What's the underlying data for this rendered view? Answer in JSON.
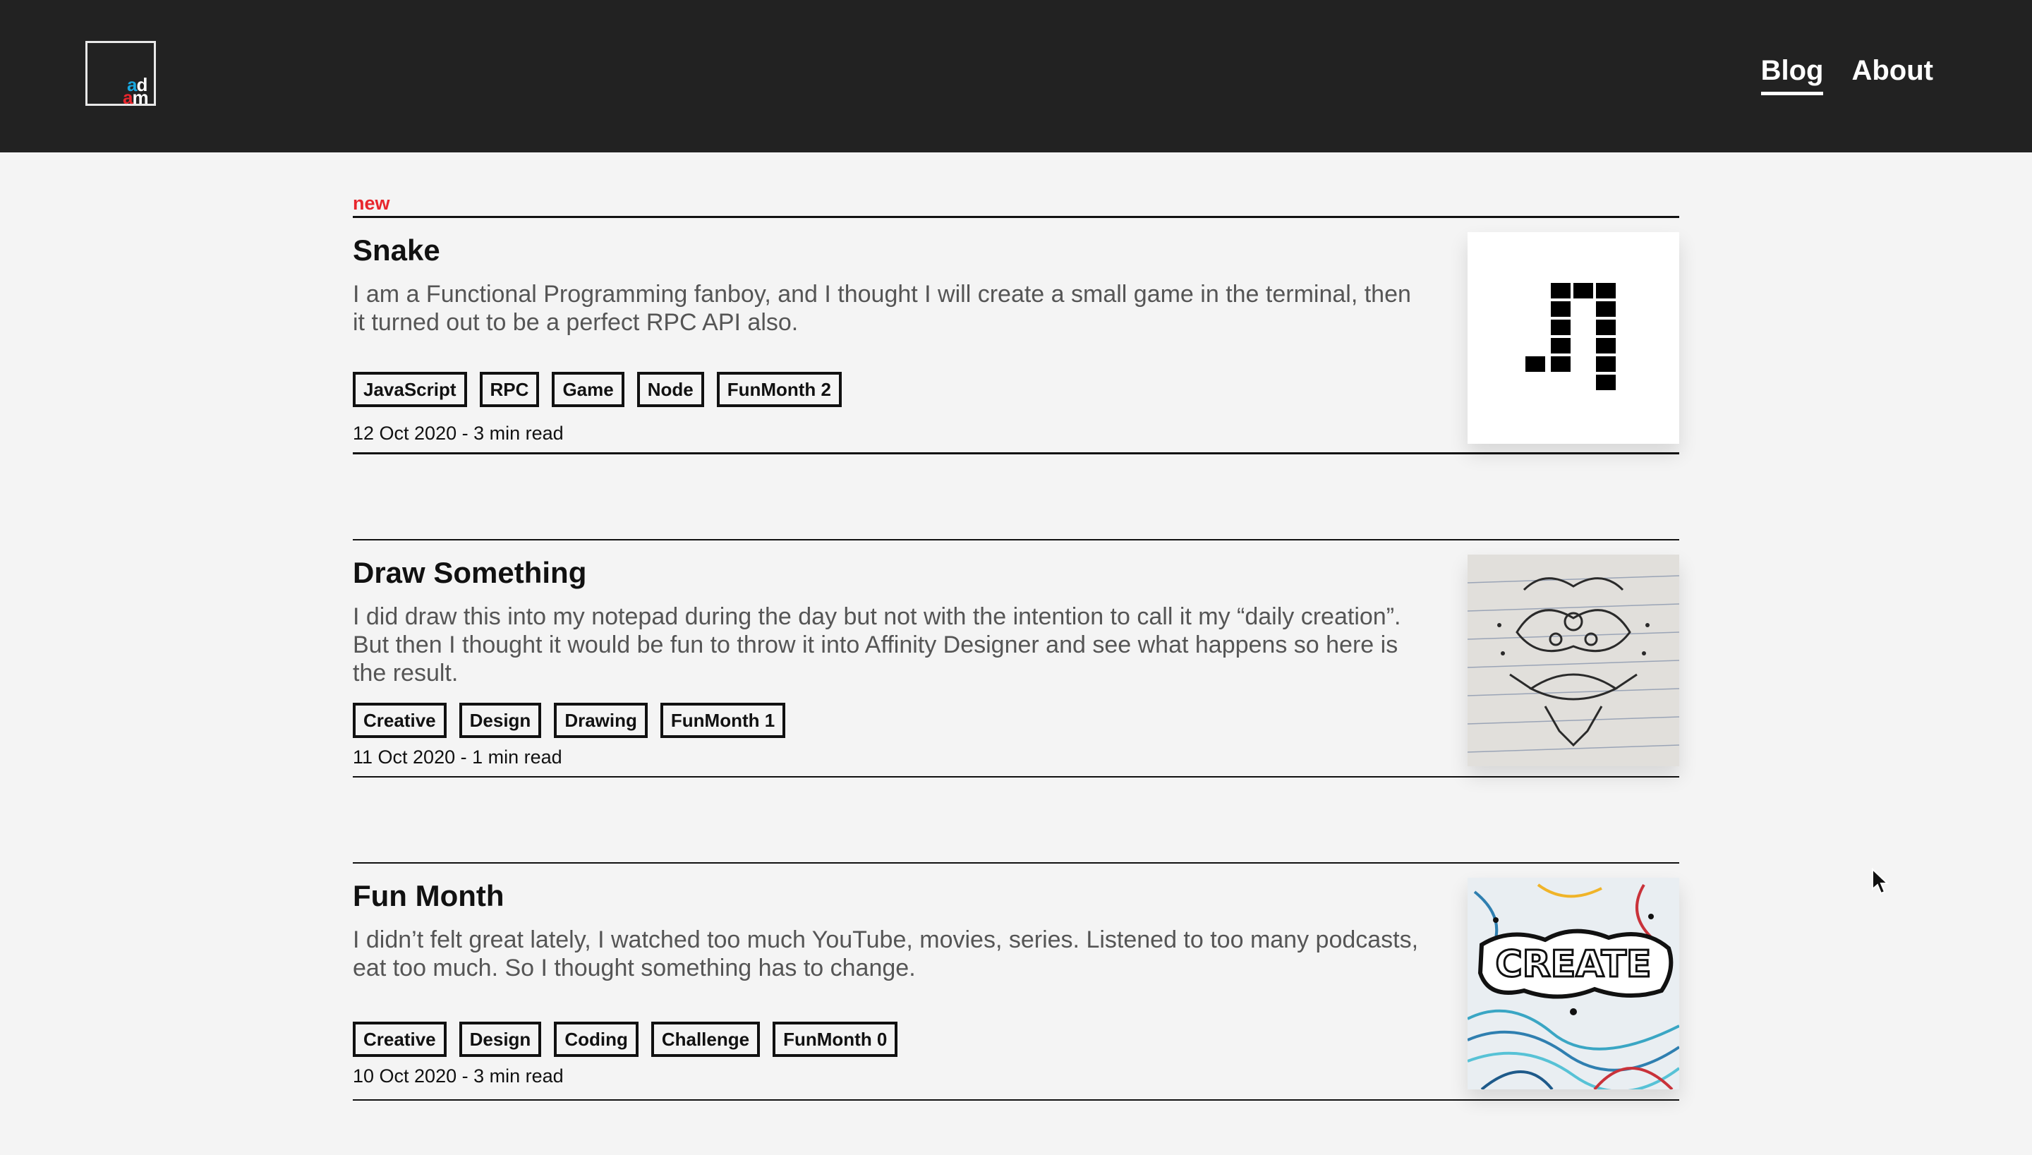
{
  "header": {
    "logo": {
      "line1": "ad",
      "line2": "am"
    },
    "nav": [
      {
        "label": "Blog",
        "active": true
      },
      {
        "label": "About",
        "active": false
      }
    ]
  },
  "main": {
    "new_label": "new",
    "posts": [
      {
        "title": "Snake",
        "excerpt": "I am a Functional Programming fanboy, and I thought I will create a small game in the terminal, then it turned out to be a perfect RPC API also.",
        "tags": [
          "JavaScript",
          "RPC",
          "Game",
          "Node",
          "FunMonth 2"
        ],
        "meta": "12 Oct 2020 - 3 min read",
        "thumbnail_icon": "snake-pixel-icon"
      },
      {
        "title": "Draw Something",
        "excerpt": "I did draw this into my notepad during the day but not with the intention to call it my “daily creation”. But then I thought it would be fun to throw it into Affinity Designer and see what happens so here is the result.",
        "tags": [
          "Creative",
          "Design",
          "Drawing",
          "FunMonth 1"
        ],
        "meta": "11 Oct 2020 - 1 min read",
        "thumbnail_icon": "notepad-sketch-image"
      },
      {
        "title": "Fun Month",
        "excerpt": "I didn’t felt great lately, I watched too much YouTube, movies, series. Listened to too many podcasts, eat too much. So I thought something has to change.",
        "tags": [
          "Creative",
          "Design",
          "Coding",
          "Challenge",
          "FunMonth 0"
        ],
        "meta": "10 Oct 2020 - 3 min read",
        "thumbnail_icon": "create-doodle-image",
        "thumbnail_text": "CREATE"
      }
    ]
  },
  "colors": {
    "header_bg": "#222222",
    "page_bg": "#f4f4f4",
    "accent_red": "#e8262d",
    "accent_blue": "#19a8e0"
  }
}
